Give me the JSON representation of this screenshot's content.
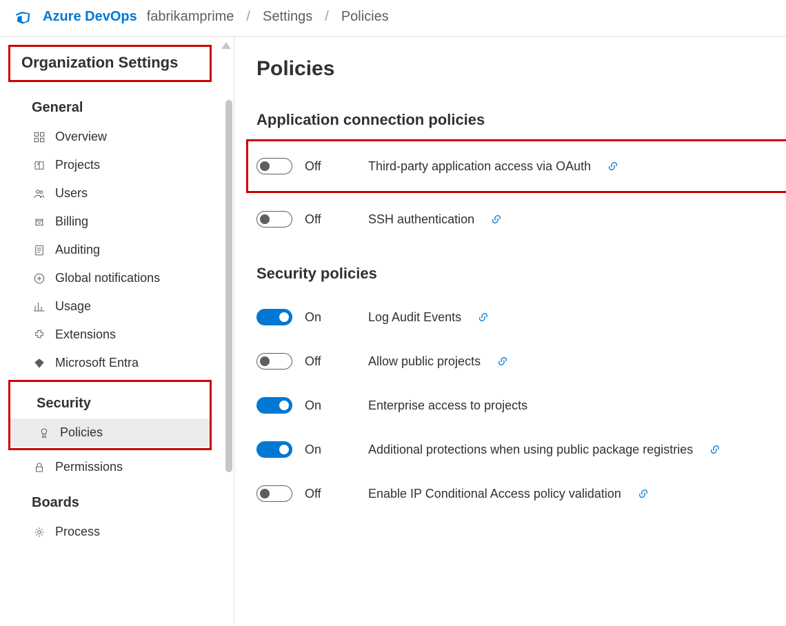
{
  "header": {
    "product": "Azure DevOps",
    "crumb_org": "fabrikamprime",
    "crumb_settings": "Settings",
    "crumb_policies": "Policies"
  },
  "sidebar": {
    "title": "Organization Settings",
    "sections": {
      "general": {
        "label": "General",
        "items": {
          "overview": "Overview",
          "projects": "Projects",
          "users": "Users",
          "billing": "Billing",
          "auditing": "Auditing",
          "global_notifications": "Global notifications",
          "usage": "Usage",
          "extensions": "Extensions",
          "entra": "Microsoft Entra"
        }
      },
      "security": {
        "label": "Security",
        "items": {
          "policies": "Policies",
          "permissions": "Permissions"
        }
      },
      "boards": {
        "label": "Boards",
        "items": {
          "process": "Process"
        }
      }
    }
  },
  "main": {
    "title": "Policies",
    "groups": {
      "app_conn": {
        "heading": "Application connection policies",
        "policies": {
          "oauth": {
            "state": "Off",
            "label": "Third-party application access via OAuth",
            "has_link": true
          },
          "ssh": {
            "state": "Off",
            "label": "SSH authentication",
            "has_link": true
          }
        }
      },
      "security": {
        "heading": "Security policies",
        "policies": {
          "audit": {
            "state": "On",
            "label": "Log Audit Events",
            "has_link": true
          },
          "public": {
            "state": "Off",
            "label": "Allow public projects",
            "has_link": true
          },
          "enterprise": {
            "state": "On",
            "label": "Enterprise access to projects",
            "has_link": false
          },
          "pkgreg": {
            "state": "On",
            "label": "Additional protections when using public package registries",
            "has_link": true
          },
          "ipcond": {
            "state": "Off",
            "label": "Enable IP Conditional Access policy validation",
            "has_link": true
          }
        }
      }
    }
  },
  "toggle_labels": {
    "on": "On",
    "off": "Off"
  }
}
